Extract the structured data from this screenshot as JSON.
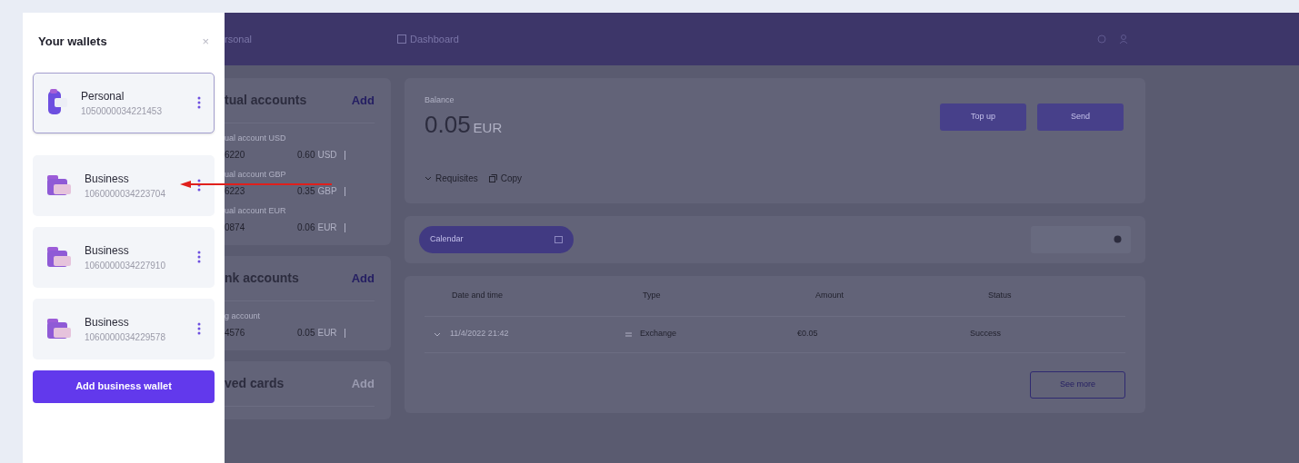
{
  "drawer": {
    "title": "Your wallets",
    "close": "×",
    "wallets": [
      {
        "kind": "personal",
        "name": "Personal",
        "number": "1050000034221453",
        "selected": true
      },
      {
        "kind": "business",
        "name": "Business",
        "number": "1060000034223704",
        "selected": false
      },
      {
        "kind": "business",
        "name": "Business",
        "number": "1060000034227910",
        "selected": false
      },
      {
        "kind": "business",
        "name": "Business",
        "number": "1060000034229578",
        "selected": false
      }
    ],
    "add_button": "Add business wallet"
  },
  "topbar": {
    "wallet": "rsonal",
    "tab": "Dashboard"
  },
  "sidebar": {
    "sections": [
      {
        "title": "tual accounts",
        "action": "Add",
        "accounts": [
          {
            "label": "ual account USD",
            "number": "6220",
            "amount": "0.60",
            "currency": "USD"
          },
          {
            "label": "ual account GBP",
            "number": "6223",
            "amount": "0.35",
            "currency": "GBP"
          },
          {
            "label": "ual account EUR",
            "number": "0874",
            "amount": "0.06",
            "currency": "EUR"
          }
        ]
      },
      {
        "title": "nk accounts",
        "action": "Add",
        "accounts": [
          {
            "label": "g account",
            "number": "4576",
            "amount": "0.05",
            "currency": "EUR"
          }
        ]
      },
      {
        "title": "ved cards",
        "action": "Add"
      }
    ]
  },
  "balance": {
    "label": "Balance",
    "amount": "0.05",
    "currency": "EUR",
    "buttons": [
      "Top up",
      "Send"
    ],
    "links": [
      {
        "kind": "expand",
        "label": "Requisites"
      },
      {
        "kind": "copy",
        "label": "Copy"
      }
    ]
  },
  "filters": {
    "calendar": "Calendar"
  },
  "table": {
    "columns": [
      "Date and time",
      "Type",
      "Amount",
      "Status"
    ],
    "rows": [
      {
        "date": "11/4/2022 21:42",
        "type": "Exchange",
        "amount": "€0.05",
        "status": "Success"
      }
    ],
    "more": "See more"
  }
}
